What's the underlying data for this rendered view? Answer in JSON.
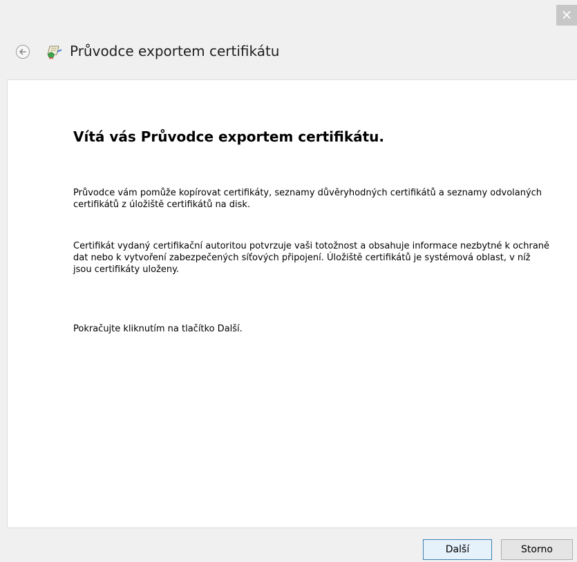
{
  "window": {
    "close_glyph": "×"
  },
  "header": {
    "title": "Průvodce exportem certifikátu",
    "back_icon": "back-arrow-icon",
    "wizard_icon": "certificate-icon"
  },
  "content": {
    "heading": "Vítá vás Průvodce exportem certifikátu.",
    "paragraph1": "Průvodce vám pomůže kopírovat certifikáty, seznamy důvěryhodných certifikátů a seznamy odvolaných certifikátů z úložiště certifikátů na disk.",
    "paragraph2": "Certifikát vydaný certifikační autoritou potvrzuje vaši totožnost a obsahuje informace nezbytné k ochraně dat nebo k vytvoření zabezpečených síťových připojení. Úložiště certifikátů je systémová oblast, v níž jsou certifikáty uloženy.",
    "paragraph3": "Pokračujte kliknutím na tlačítko Další."
  },
  "footer": {
    "next_label": "Další",
    "cancel_label": "Storno"
  },
  "colors": {
    "accent": "#3c7fb1",
    "background": "#f0f0f0",
    "panel": "#ffffff"
  }
}
